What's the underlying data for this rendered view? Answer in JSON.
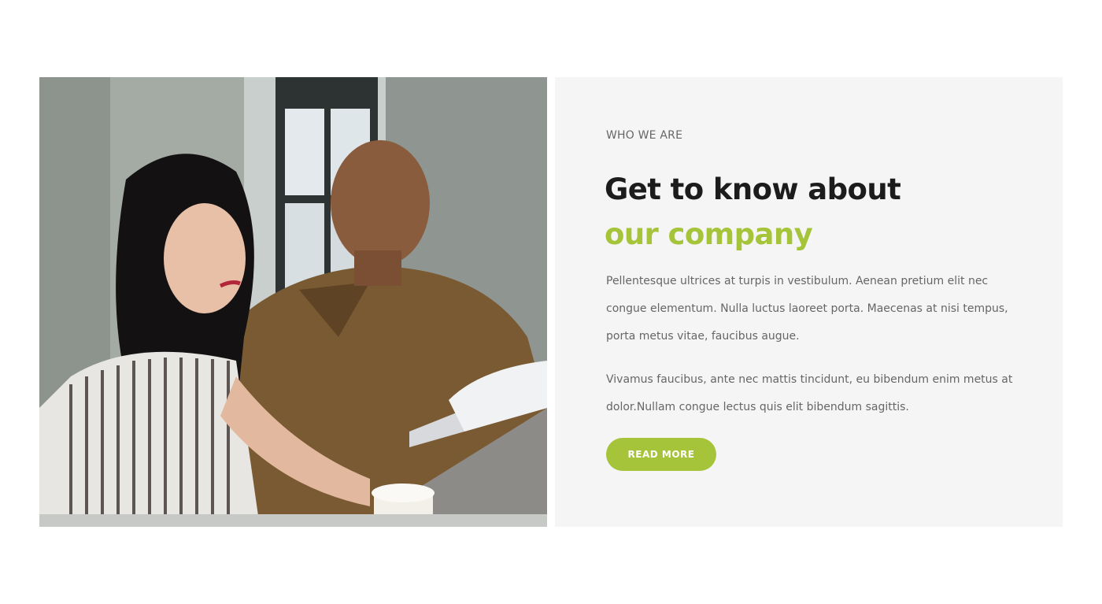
{
  "about": {
    "eyebrow": "WHO WE ARE",
    "title_line1": "Get to know about",
    "title_line2": "our company",
    "paragraph1": "Pellentesque ultrices at turpis in vestibulum. Aenean pretium elit nec congue elementum. Nulla luctus laoreet porta. Maecenas at nisi tempus, porta metus vitae, faucibus augue.",
    "paragraph2": "Vivamus faucibus, ante nec mattis tincidunt, eu bibendum enim metus at dolor.Nullam congue lectus quis elit bibendum sagittis.",
    "button_label": "READ MORE"
  },
  "colors": {
    "accent": "#a5c43a",
    "heading": "#1c1c1c",
    "body_text": "#666666",
    "panel_background": "#f5f5f5"
  }
}
